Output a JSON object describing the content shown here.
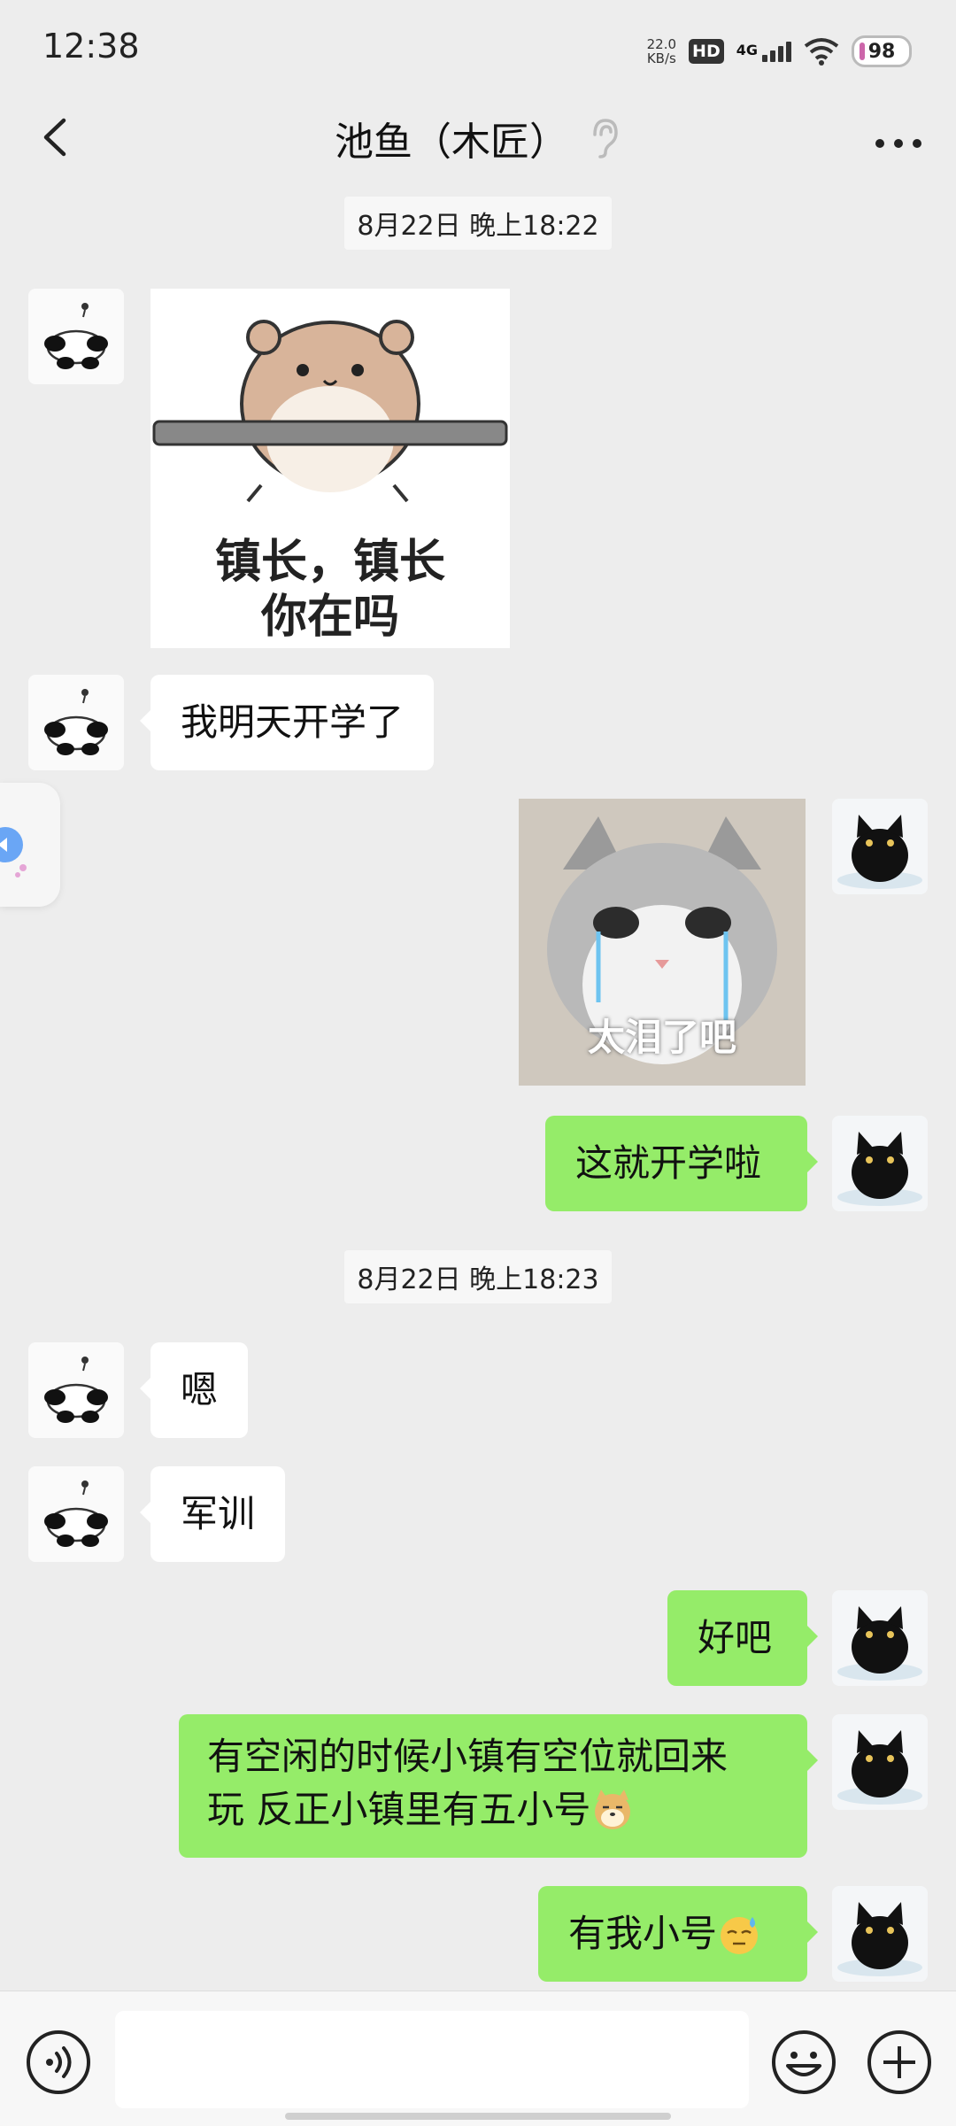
{
  "status_bar": {
    "time": "12:38",
    "net_speed_value": "22.0",
    "net_speed_unit": "KB/s",
    "hd_label": "HD",
    "network_label": "4G",
    "battery": "98"
  },
  "header": {
    "title": "池鱼（木匠）",
    "icons": [
      "back-arrow-icon",
      "ear-icon",
      "more-icon"
    ]
  },
  "messages": {
    "timestamp_1": "8月22日 晚上18:22",
    "sticker_hamster_caption_line1": "镇长，镇长",
    "sticker_hamster_caption_line2": "你在吗",
    "msg_1": "我明天开学了",
    "sticker_cat_caption": "太泪了吧",
    "msg_2": "这就开学啦",
    "timestamp_2": "8月22日 晚上18:23",
    "msg_3": "嗯",
    "msg_4": "军训",
    "msg_5": "好吧",
    "msg_6_line1": "有空闲的时候小镇有空位就回来",
    "msg_6_line2": "玩 反正小镇里有五小号",
    "msg_7": "有我小号"
  },
  "input_bar": {
    "icons": [
      "voice-icon",
      "emoji-icon",
      "plus-icon"
    ]
  },
  "colors": {
    "background": "#ededed",
    "bubble_self": "#95ec69",
    "bubble_other": "#ffffff"
  }
}
